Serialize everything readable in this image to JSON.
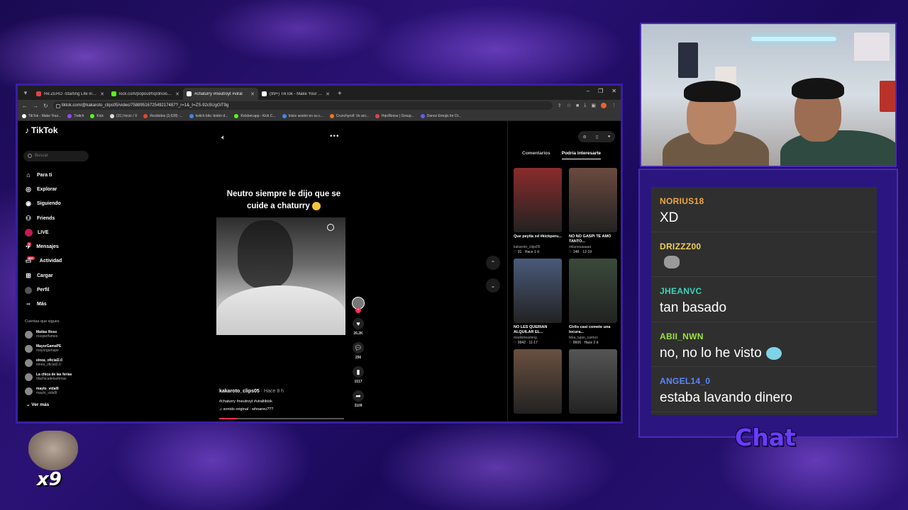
{
  "browser": {
    "tabs": [
      {
        "title": "Re:ZERO -Starting Life in Anoth",
        "color": "#e04444",
        "active": false
      },
      {
        "title": "kick.com/popout/hqrdnoise/ch",
        "color": "#53fc18",
        "active": false
      },
      {
        "title": "#chaturry #neutroyt #viral",
        "color": "#ffffff",
        "active": true
      },
      {
        "title": "(99+) TikTok - Make Your Day",
        "color": "#ffffff",
        "active": false
      }
    ],
    "url": "tiktok.com/@kakaroto_clips05/video/7588951672549217487?_r=1&_t=ZS-92c5UgGlT9g",
    "bookmarks": [
      {
        "label": "TikTok - Make Your...",
        "color": "#ffffff"
      },
      {
        "label": "Twitch",
        "color": "#9146ff"
      },
      {
        "label": "Kick",
        "color": "#53fc18"
      },
      {
        "label": "(31) Inicio / X",
        "color": "#dddddd"
      },
      {
        "label": "Recibidos (3,628) -...",
        "color": "#ea4335"
      },
      {
        "label": "twitch bits: botón d...",
        "color": "#4285f4"
      },
      {
        "label": "Kickbet.app - Kick C...",
        "color": "#53fc18"
      },
      {
        "label": "Inicie sesión en su c...",
        "color": "#4285f4"
      },
      {
        "label": "Crunchyroll: Ve ani...",
        "color": "#f47521"
      },
      {
        "label": "HqrdNoise | Group...",
        "color": "#e04444"
      },
      {
        "label": "Dance Emojis for Di...",
        "color": "#5865f2"
      }
    ]
  },
  "tiktok": {
    "logo": "TikTok",
    "search_placeholder": "Buscar",
    "nav": [
      {
        "label": "Para ti",
        "icon": "home-icon"
      },
      {
        "label": "Explorar",
        "icon": "compass-icon"
      },
      {
        "label": "Siguiendo",
        "icon": "following-icon"
      },
      {
        "label": "Friends",
        "icon": "friends-icon"
      },
      {
        "label": "LIVE",
        "icon": "live-icon"
      },
      {
        "label": "Mensajes",
        "icon": "message-icon",
        "badge": "1"
      },
      {
        "label": "Actividad",
        "icon": "activity-icon",
        "badge": "99+"
      },
      {
        "label": "Cargar",
        "icon": "upload-icon"
      },
      {
        "label": "Perfil",
        "icon": "profile-icon"
      },
      {
        "label": "Más",
        "icon": "more-icon"
      }
    ],
    "following_title": "Cuentas que sigues",
    "following": [
      {
        "name": "Matías Ross",
        "handle": "rossperfumes"
      },
      {
        "name": "MayorGamaPE",
        "handle": "mayorgamape"
      },
      {
        "name": "elnea_oficial2.0",
        "handle": "elnea_oficial2.0"
      },
      {
        "name": "La chica de las ferias",
        "handle": "0lachicadelasferias"
      },
      {
        "name": "mayto_vidal9",
        "handle": "mayto_vidal9"
      }
    ],
    "see_more": "Ver más",
    "video": {
      "caption": "Neutro siempre le dijo que se cuide a chaturry",
      "author": "kakaroto_clips05",
      "posted": "· Hace 8 h",
      "hashtags": "#chaturry #neutroyt #viraltiktok",
      "sound": "♫  sonido original - whoareu???",
      "progress": 0.15,
      "likes": "26.2K",
      "comments": "256",
      "saves": "1517",
      "shares": "3109"
    },
    "right_tabs": [
      "Comentarios",
      "Podría interesarte"
    ],
    "cards": [
      {
        "title": "Que peyita xd #kickperu...",
        "user": "kakaroto_clips05",
        "stats": "♡ 91 · Hace 1 d",
        "color": "#8a2b2b"
      },
      {
        "title": "NO NO GASPI TE AMO TANTO...",
        "user": "milunesaaaaa",
        "stats": "♡ 14K · 12-19",
        "color": "#6b4a3e"
      },
      {
        "title": "NO LES QUERIAN ALQUILAR EL...",
        "user": "madistreaming",
        "stats": "♡ 9942 · 11-17",
        "color": "#4a5a7a"
      },
      {
        "title": "Cirilo casi comete una locura...",
        "user": "feka_lujan_carrion",
        "stats": "♡ 8606 · Hace 2 d",
        "color": "#3a4a3a"
      },
      {
        "title": "",
        "user": "",
        "stats": "",
        "color": "#6a5040"
      },
      {
        "title": "",
        "user": "",
        "stats": "",
        "color": "#555555"
      }
    ]
  },
  "chat": {
    "messages": [
      {
        "user": "NORIUS18",
        "text": "XD",
        "color": "#f0a640",
        "emote": ""
      },
      {
        "user": "DRIZZZ00",
        "text": "",
        "color": "#f0d060",
        "emote": "gray"
      },
      {
        "user": "JHEANVC",
        "text": "tan basado",
        "color": "#3fd3b8",
        "emote": ""
      },
      {
        "user": "ABII_NWN",
        "text": "no, no lo he visto",
        "color": "#9be73a",
        "emote": "blue"
      },
      {
        "user": "ANGEL14_0",
        "text": "estaba lavando dinero",
        "color": "#5b87ff",
        "emote": ""
      }
    ],
    "label": "Chat"
  },
  "overlay": {
    "multiplier": "x9"
  }
}
